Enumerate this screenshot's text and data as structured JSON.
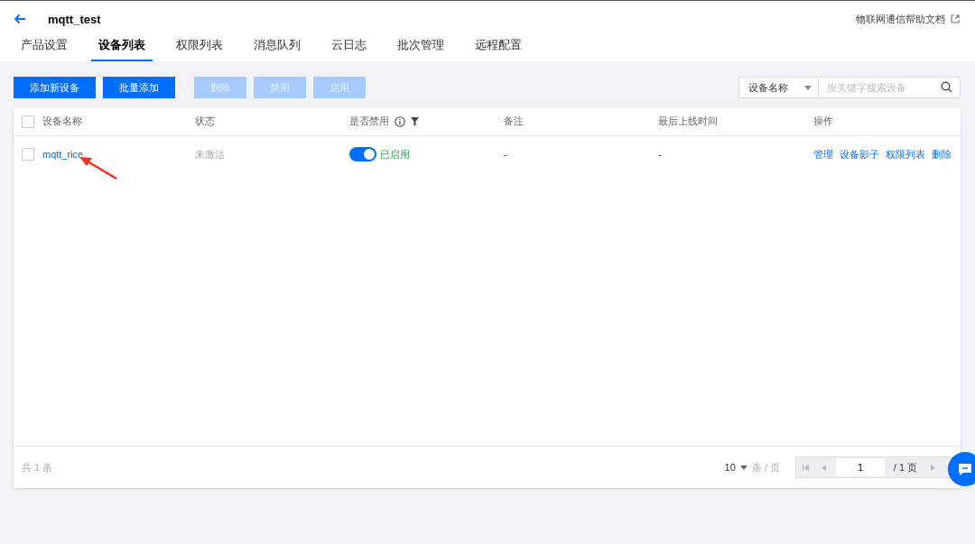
{
  "header": {
    "title": "mqtt_test",
    "help_link": "物联网通信帮助文档"
  },
  "tabs": [
    {
      "label": "产品设置",
      "selected": false
    },
    {
      "label": "设备列表",
      "selected": true
    },
    {
      "label": "权限列表",
      "selected": false
    },
    {
      "label": "消息队列",
      "selected": false
    },
    {
      "label": "云日志",
      "selected": false
    },
    {
      "label": "批次管理",
      "selected": false
    },
    {
      "label": "远程配置",
      "selected": false
    }
  ],
  "toolbar": {
    "buttons": [
      {
        "label": "添加新设备",
        "disabled": false
      },
      {
        "label": "批量添加",
        "disabled": false
      },
      {
        "label": "删除",
        "disabled": true
      },
      {
        "label": "禁用",
        "disabled": true
      },
      {
        "label": "启用",
        "disabled": true
      }
    ],
    "search_type": "设备名称",
    "search": {
      "placeholder": "按关键字搜索设备"
    }
  },
  "table": {
    "select_all": false,
    "columns": [
      "设备名称",
      "状态",
      "是否禁用",
      "备注",
      "最后上线时间",
      "操作"
    ],
    "rows": [
      {
        "checked": false,
        "name": "mqtt_rice",
        "status": "未激活",
        "enabled": true,
        "enabled_label": "已启用",
        "remark": "-",
        "last_online": "-",
        "actions": [
          "管理",
          "设备影子",
          "权限列表",
          "删除"
        ]
      }
    ]
  },
  "footer": {
    "total": "共 1 条",
    "page_size": "10",
    "per_page": "条 / 页",
    "page": "1",
    "page_count": "/ 1 页"
  }
}
